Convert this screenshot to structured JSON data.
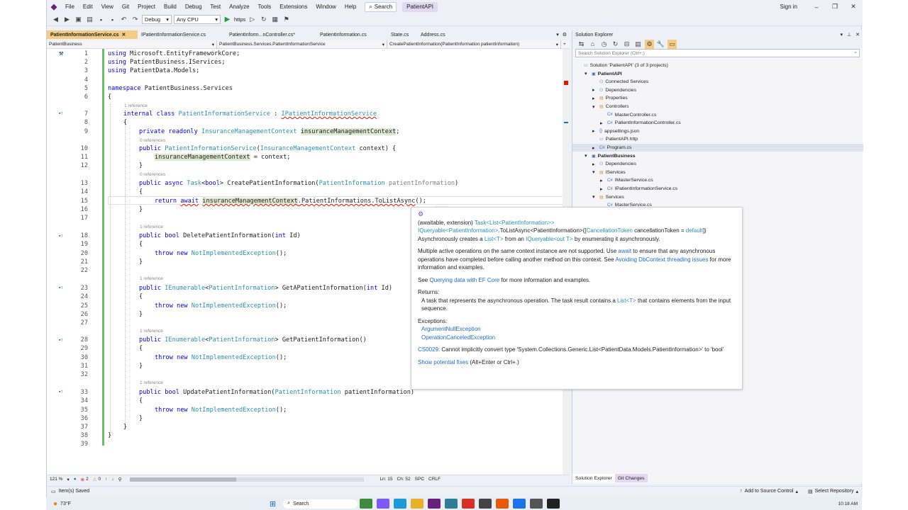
{
  "menubar": {
    "items": [
      "File",
      "Edit",
      "View",
      "Git",
      "Project",
      "Build",
      "Debug",
      "Test",
      "Analyze",
      "Tools",
      "Extensions",
      "Window",
      "Help"
    ],
    "search_label": "Search",
    "solution_name": "PatientAPI",
    "signin": "Sign in"
  },
  "toolbar": {
    "config": "Debug",
    "platform": "Any CPU",
    "run_label": "https"
  },
  "tabs": [
    "PatientInformationService.cs",
    "IPatientInformationService.cs",
    "PatientInform...nController.cs*",
    "PatientInformation.cs",
    "State.cs",
    "Address.cs"
  ],
  "nav": {
    "project": "PatientBusiness",
    "class": "PatientBusiness.Services.PatientInformationService",
    "member": "CreatePatientInformation(PatientInformation patientInformation)"
  },
  "code": {
    "line_numbers": [
      "1",
      "2",
      "3",
      "4",
      "5",
      "6",
      "7",
      "8",
      "9",
      "10",
      "11",
      "12",
      "13",
      "14",
      "15",
      "16",
      "17",
      "18",
      "19",
      "20",
      "21",
      "22",
      "23",
      "24",
      "25",
      "26",
      "27",
      "28",
      "29",
      "30",
      "31",
      "32",
      "33",
      "34",
      "35",
      "36",
      "37",
      "38",
      "39"
    ],
    "refs": {
      "r1": "1 reference",
      "r2": "0 references",
      "r3": "0 references",
      "r4": "1 reference",
      "r5": "1 reference",
      "r6": "1 reference",
      "r7": "1 reference"
    }
  },
  "status": {
    "zoom": "121 %",
    "errors": "2",
    "warnings": "0",
    "position": "Ln: 15",
    "col": "Ch: 52",
    "spc": "SPC",
    "crlf": "CRLF"
  },
  "bottom": {
    "saved": "Item(s) Saved",
    "source_control": "Add to Source Control",
    "repo": "Select Repository"
  },
  "solution_explorer": {
    "title": "Solution Explorer",
    "search_placeholder": "Search Solution Explorer (Ctrl+;)",
    "tree": [
      "Solution 'PatientAPI' (3 of 3 projects)",
      "PatientAPI",
      "Connected Services",
      "Dependencies",
      "Properties",
      "Controllers",
      "MasterController.cs",
      "PatientInformationController.cs",
      "appsettings.json",
      "PatientAPI.http",
      "Program.cs",
      "PatientBusiness",
      "Dependencies",
      "IServices",
      "IMasterService.cs",
      "IPatientInformationService.cs",
      "Services",
      "MasterService.cs"
    ],
    "bottom_tabs": [
      "Solution Explorer",
      "Git Changes"
    ]
  },
  "tooltip": {
    "sig1a": "(awaitable, extension) ",
    "sig1b": "Task<List<PatientInformation>>",
    "sig2a": "IQueryable<PatientInformation>",
    "sig2b": ".ToListAsync<PatientInformation>([",
    "sig2c": "CancellationToken",
    "sig2d": " cancellationToken = ",
    "sig2e": "default",
    "sig2f": "])",
    "desc_a": "Asynchronously creates a ",
    "desc_b": "List<T>",
    "desc_c": " from an ",
    "desc_d": "IQueryable<out T>",
    "desc_e": " by enumerating it asynchronously.",
    "p2a": "Multiple active operations on the same context instance are not supported. Use ",
    "p2b": "await",
    "p2c": " to ensure that any asynchronous operations have completed before calling another method on this context. See ",
    "p2d": "Avoiding DbContext threading issues",
    "p2e": " for more information and examples.",
    "p3a": "See ",
    "p3b": "Querying data with EF Core",
    "p3c": " for more information and examples.",
    "returns_h": "Returns:",
    "returns_a": "A task that represents the asynchronous operation. The task result contains a ",
    "returns_b": "List<T>",
    "returns_c": " that contains elements from the input sequence.",
    "exc_h": "Exceptions:",
    "exc1": "ArgumentNullException",
    "exc2": "OperationCanceledException",
    "err_code": "CS0029",
    "err_msg": ": Cannot implicitly convert type 'System.Collections.Generic.List<PatientData.Models.PatientInformation>' to 'bool'",
    "fix_link": "Show potential fixes",
    "fix_keys": " (Alt+Enter or Ctrl+.)"
  },
  "taskbar": {
    "weather": "73°F",
    "search": "Search",
    "time": "10:18 AM"
  }
}
